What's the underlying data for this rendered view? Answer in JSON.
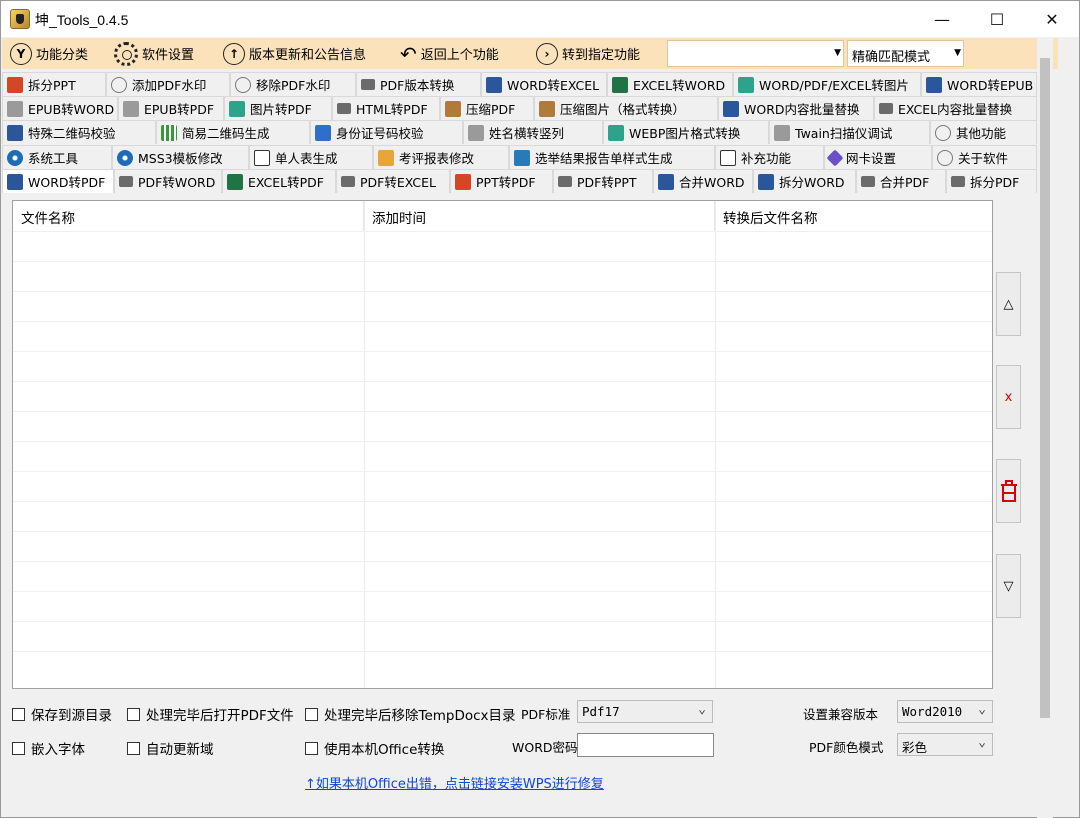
{
  "window": {
    "title": "坤_Tools_0.4.5"
  },
  "toolbar": {
    "items": [
      "功能分类",
      "软件设置",
      "版本更新和公告信息",
      "返回上个功能",
      "转到指定功能"
    ],
    "search_value": "",
    "match_mode": "精确匹配模式"
  },
  "tabs": {
    "row1": [
      {
        "label": "拆分PPT",
        "icon": "ppt-icon"
      },
      {
        "label": "添加PDF水印",
        "icon": "watermark-icon"
      },
      {
        "label": "移除PDF水印",
        "icon": "watermark-icon"
      },
      {
        "label": "PDF版本转换",
        "icon": "pdf-icon"
      },
      {
        "label": "WORD转EXCEL",
        "icon": "word-icon"
      },
      {
        "label": "EXCEL转WORD",
        "icon": "excel-icon"
      },
      {
        "label": "WORD/PDF/EXCEL转图片",
        "icon": "image-icon"
      },
      {
        "label": "WORD转EPUB",
        "icon": "word-icon"
      }
    ],
    "row2": [
      {
        "label": "EPUB转WORD",
        "icon": "epub-icon"
      },
      {
        "label": "EPUB转PDF",
        "icon": "epub-icon"
      },
      {
        "label": "图片转PDF",
        "icon": "image-icon"
      },
      {
        "label": "HTML转PDF",
        "icon": "pdf-icon"
      },
      {
        "label": "压缩PDF",
        "icon": "compress-icon"
      },
      {
        "label": "压缩图片（格式转换）",
        "icon": "compress-icon"
      },
      {
        "label": "WORD内容批量替换",
        "icon": "word-icon"
      },
      {
        "label": "EXCEL内容批量替换",
        "icon": "pdf-icon"
      }
    ],
    "row3": [
      {
        "label": "特殊二维码校验",
        "icon": "word-icon"
      },
      {
        "label": "简易二维码生成",
        "icon": "qr-icon"
      },
      {
        "label": "身份证号码校验",
        "icon": "id-card-icon"
      },
      {
        "label": "姓名横转竖列",
        "icon": "name-icon"
      },
      {
        "label": "WEBP图片格式转换",
        "icon": "image-icon"
      },
      {
        "label": "Twain扫描仪调试",
        "icon": "scanner-icon"
      },
      {
        "label": "其他功能",
        "icon": "more-icon"
      }
    ],
    "row4": [
      {
        "label": "系统工具",
        "icon": "gear-icon"
      },
      {
        "label": "MSS3模板修改",
        "icon": "gear-icon"
      },
      {
        "label": "单人表生成",
        "icon": "document-icon"
      },
      {
        "label": "考评报表修改",
        "icon": "pen-icon"
      },
      {
        "label": "选举结果报告单样式生成",
        "icon": "book-icon"
      },
      {
        "label": "补充功能",
        "icon": "document-icon"
      },
      {
        "label": "网卡设置",
        "icon": "network-icon"
      },
      {
        "label": "关于软件",
        "icon": "info-icon"
      }
    ],
    "row5": [
      {
        "label": "WORD转PDF",
        "icon": "word-icon",
        "selected": true
      },
      {
        "label": "PDF转WORD",
        "icon": "pdf-icon"
      },
      {
        "label": "EXCEL转PDF",
        "icon": "excel-icon"
      },
      {
        "label": "PDF转EXCEL",
        "icon": "pdf-icon"
      },
      {
        "label": "PPT转PDF",
        "icon": "ppt-icon"
      },
      {
        "label": "PDF转PPT",
        "icon": "pdf-icon"
      },
      {
        "label": "合并WORD",
        "icon": "word-icon"
      },
      {
        "label": "拆分WORD",
        "icon": "word-icon"
      },
      {
        "label": "合并PDF",
        "icon": "pdf-icon"
      },
      {
        "label": "拆分PDF",
        "icon": "pdf-icon"
      }
    ]
  },
  "table": {
    "columns": [
      "文件名称",
      "添加时间",
      "转换后文件名称"
    ],
    "rows": []
  },
  "side_buttons": {
    "up": "△",
    "delete": "x",
    "down": "▽"
  },
  "options": {
    "save_to_source": "保存到源目录",
    "open_pdf_after": "处理完毕后打开PDF文件",
    "remove_temp": "处理完毕后移除TempDocx目录",
    "embed_fonts": "嵌入字体",
    "auto_update_fields": "自动更新域",
    "use_local_office": "使用本机Office转换",
    "pdf_standard_label": "PDF标准",
    "pdf_standard_value": "Pdf17",
    "word_password_label": "WORD密码",
    "word_password_value": "",
    "compat_label": "设置兼容版本",
    "compat_value": "Word2010",
    "color_label": "PDF颜色模式",
    "color_value": "彩色"
  },
  "link_text": "↑如果本机Office出错，点击链接安装WPS进行修复"
}
